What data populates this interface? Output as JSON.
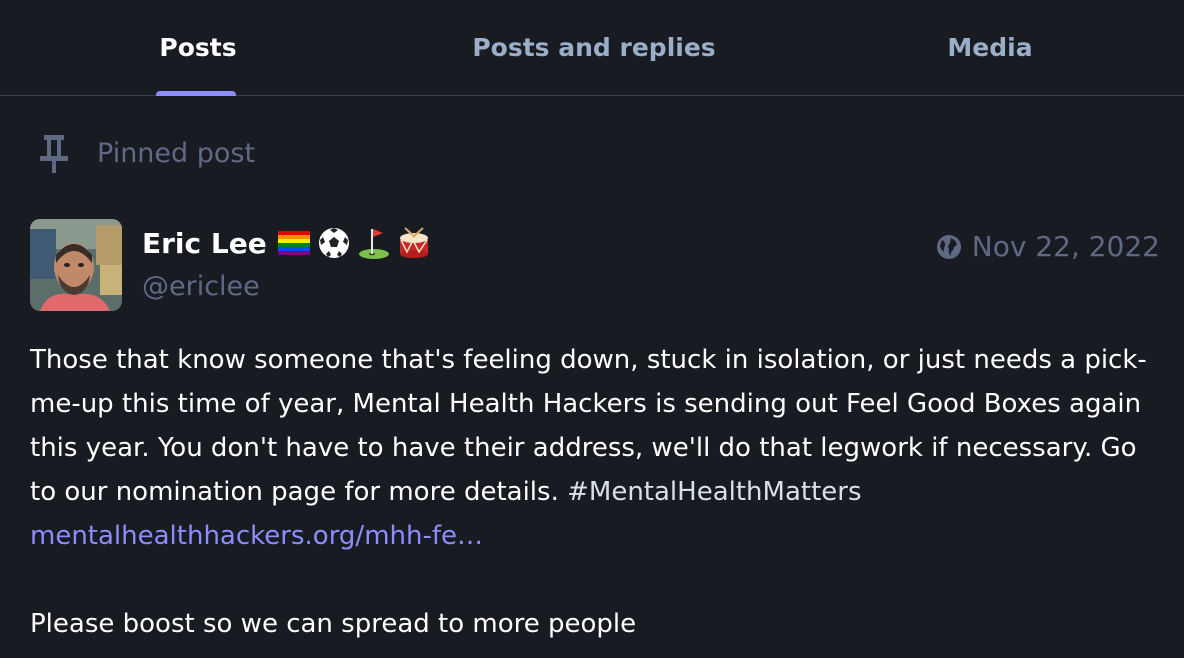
{
  "tabs": [
    {
      "label": "Posts",
      "active": true
    },
    {
      "label": "Posts and replies",
      "active": false
    },
    {
      "label": "Media",
      "active": false
    }
  ],
  "pinned": {
    "label": "Pinned post",
    "icon": "pin-icon"
  },
  "post": {
    "author": {
      "name": "Eric Lee",
      "handle": "@ericlee",
      "emojis": [
        "rainbow-flag",
        "soccer-ball",
        "golf-flag",
        "drum"
      ]
    },
    "visibility_icon": "globe-icon",
    "date": "Nov 22, 2022",
    "body": {
      "text": "Those that know someone that's feeling down, stuck in isolation, or just needs a pick-me-up this time of year, Mental Health Hackers is sending out Feel Good Boxes again this year.  You don't have to have their address, we'll do that legwork if necessary.  Go to our nomination page for more details. ",
      "hashtag": "#MentalHealthMatters",
      "link": "mentalhealthhackers.org/mhh-fe…",
      "footer": "Please boost so we can spread to more people"
    }
  },
  "colors": {
    "background": "#191b22",
    "accent": "#8c8dff",
    "muted": "#606984",
    "tab_inactive": "#9baec8"
  }
}
